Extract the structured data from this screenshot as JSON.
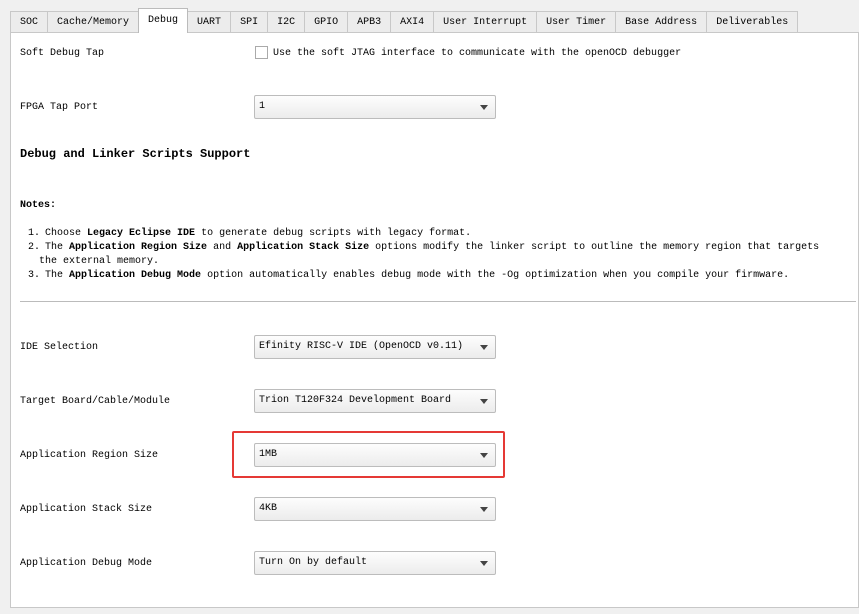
{
  "tabs": [
    {
      "label": "SOC"
    },
    {
      "label": "Cache/Memory"
    },
    {
      "label": "Debug",
      "active": true
    },
    {
      "label": "UART"
    },
    {
      "label": "SPI"
    },
    {
      "label": "I2C"
    },
    {
      "label": "GPIO"
    },
    {
      "label": "APB3"
    },
    {
      "label": "AXI4"
    },
    {
      "label": "User Interrupt"
    },
    {
      "label": "User Timer"
    },
    {
      "label": "Base Address"
    },
    {
      "label": "Deliverables"
    }
  ],
  "soft_debug": {
    "label": "Soft Debug Tap",
    "checkbox_label": "Use the soft JTAG interface to communicate with the openOCD debugger",
    "checked": false
  },
  "fpga_tap": {
    "label": "FPGA Tap Port",
    "value": "1"
  },
  "section_title": "Debug and Linker Scripts Support",
  "notes": {
    "title": "Notes:",
    "items": [
      {
        "n": "1.",
        "parts": [
          "Choose ",
          "Legacy Eclipse IDE",
          " to generate debug scripts with legacy format."
        ]
      },
      {
        "n": "2.",
        "parts": [
          "The ",
          "Application Region Size",
          " and ",
          "Application Stack Size",
          " options modify the linker script to outline the memory region that targets the external memory."
        ]
      },
      {
        "n": "3.",
        "parts": [
          "The ",
          "Application Debug Mode",
          " option automatically enables debug mode with the -Og optimization when you compile your firmware."
        ]
      }
    ]
  },
  "fields": [
    {
      "label": "IDE Selection",
      "value": "Efinity RISC-V IDE (OpenOCD v0.11)"
    },
    {
      "label": "Target Board/Cable/Module",
      "value": "Trion T120F324 Development Board"
    },
    {
      "label": "Application Region Size",
      "value": "1MB",
      "highlighted": true
    },
    {
      "label": "Application Stack Size",
      "value": "4KB"
    },
    {
      "label": "Application Debug Mode",
      "value": "Turn On by default"
    }
  ],
  "highlight_color": "#e53935"
}
